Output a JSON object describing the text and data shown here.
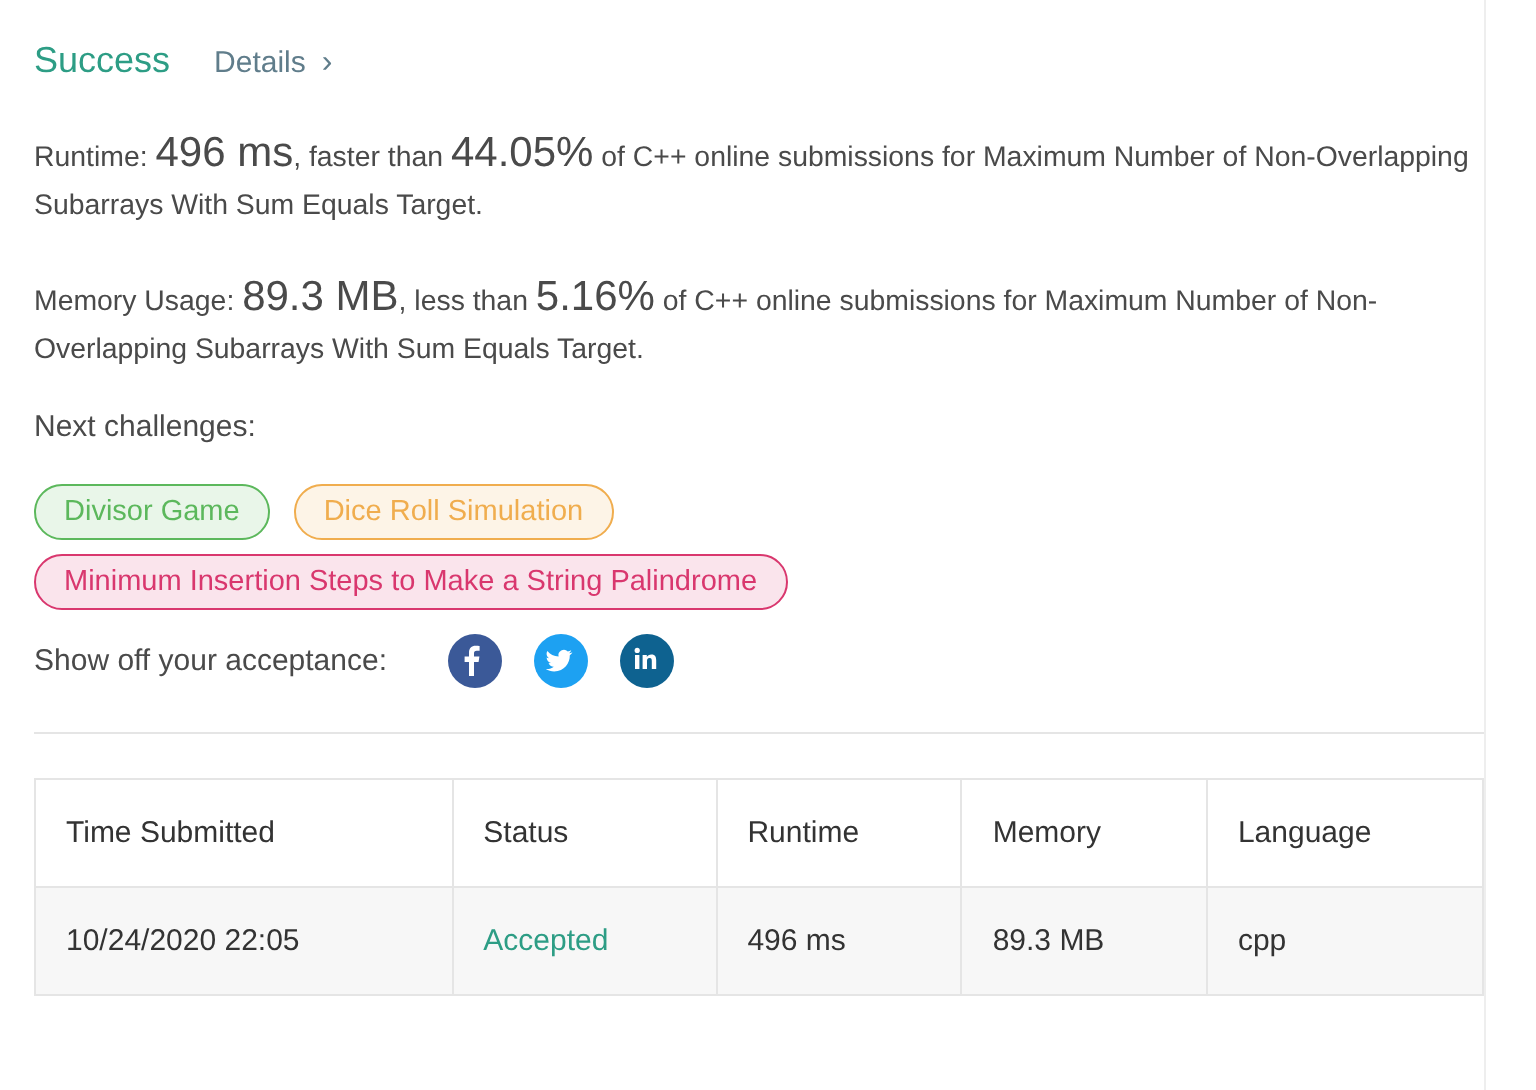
{
  "result": {
    "title": "Success",
    "details_link": "Details",
    "details_chevron": "›"
  },
  "stats": [
    {
      "parts": [
        {
          "text": "Runtime: ",
          "big": false
        },
        {
          "text": "496 ms",
          "big": true
        },
        {
          "text": ", faster than ",
          "big": false
        },
        {
          "text": "44.05%",
          "big": true
        },
        {
          "text": " of C++ online submissions for Maximum Number of Non-Overlapping Subarrays With Sum Equals Target.",
          "big": false
        }
      ]
    },
    {
      "parts": [
        {
          "text": "Memory Usage: ",
          "big": false
        },
        {
          "text": "89.3 MB",
          "big": true
        },
        {
          "text": ", less than ",
          "big": false
        },
        {
          "text": "5.16%",
          "big": true
        },
        {
          "text": " of C++ online submissions for Maximum Number of Non-Overlapping Subarrays With Sum Equals Target.",
          "big": false
        }
      ]
    }
  ],
  "next_challenges": {
    "label": "Next challenges:",
    "items": [
      {
        "title": "Divisor Game",
        "color": "#5cb85c"
      },
      {
        "title": "Dice Roll Simulation",
        "color": "#f0ad4e"
      },
      {
        "title": "Minimum Insertion Steps to Make a String Palindrome",
        "color": "#d9376e"
      }
    ]
  },
  "share": {
    "label": "Show off your acceptance:",
    "icons": [
      {
        "kind": "facebook"
      },
      {
        "kind": "twitter"
      },
      {
        "kind": "linkedin"
      }
    ]
  },
  "table": {
    "columns": [
      "Time Submitted",
      "Status",
      "Runtime",
      "Memory",
      "Language"
    ],
    "rows": [
      {
        "cells": [
          {
            "text": "10/24/2020 22:05",
            "kind": "plain"
          },
          {
            "text": "Accepted",
            "kind": "status"
          },
          {
            "text": "496 ms",
            "kind": "plain"
          },
          {
            "text": "89.3 MB",
            "kind": "plain"
          },
          {
            "text": "cpp",
            "kind": "plain"
          }
        ]
      }
    ]
  }
}
